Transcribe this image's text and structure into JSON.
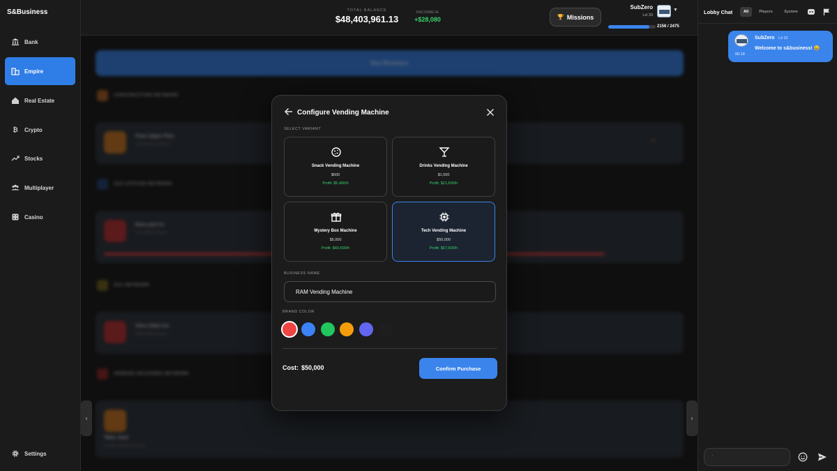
{
  "app": {
    "brand": "S&Business"
  },
  "sidebar": {
    "items": [
      {
        "label": "Bank",
        "icon": "bank-icon",
        "active": false
      },
      {
        "label": "Empire",
        "icon": "building-icon",
        "active": true
      },
      {
        "label": "Real Estate",
        "icon": "house-icon",
        "active": false
      },
      {
        "label": "Crypto",
        "icon": "bitcoin-icon",
        "active": false
      },
      {
        "label": "Stocks",
        "icon": "trend-icon",
        "active": false
      },
      {
        "label": "Multiplayer",
        "icon": "users-icon",
        "active": false
      },
      {
        "label": "Casino",
        "icon": "dice-icon",
        "active": false
      }
    ],
    "settings_label": "Settings"
  },
  "header": {
    "balance_label": "TOTAL BALANCE",
    "balance_value": "$48,403,961.13",
    "income_label": "INCOME/H",
    "income_value": "+$28,080",
    "missions_label": "Missions",
    "user": {
      "name": "SubZero",
      "level": "Lvl 33"
    },
    "xp": {
      "current": 2156,
      "max": 2475,
      "text": "2156 / 2475"
    }
  },
  "modal": {
    "title": "Configure Vending Machine",
    "select_variant_label": "SELECT VARIANT",
    "variants": [
      {
        "name": "Snack Vending Machine",
        "price": "$500",
        "profit": "Profit: $5,400/h",
        "icon": "cookie-icon",
        "selected": false
      },
      {
        "name": "Drinks Vending Machine",
        "price": "$1,500",
        "profit": "Profit: $21,600/h",
        "icon": "cocktail-icon",
        "selected": false
      },
      {
        "name": "Mystery Box Machine",
        "price": "$5,000",
        "profit": "Profit: $40,500/h",
        "icon": "gift-icon",
        "selected": false
      },
      {
        "name": "Tech Vending Machine",
        "price": "$50,000",
        "profit": "Profit: $67,500/h",
        "icon": "chip-icon",
        "selected": true
      }
    ],
    "business_name_label": "BUSINESS NAME",
    "business_name_value": "RAM Vending Machine",
    "brand_color_label": "BRAND COLOR",
    "brand_colors": [
      "#ef4444",
      "#3b82f6",
      "#22c55e",
      "#f59e0b",
      "#6366f1",
      "#1e1e1e"
    ],
    "selected_color": "#ef4444",
    "cost_label": "Cost:",
    "cost_value": "$50,000",
    "confirm_label": "Confirm Purchase"
  },
  "chat": {
    "title": "Lobby Chat",
    "tabs": [
      {
        "label": "All",
        "active": true
      },
      {
        "label": "Players",
        "active": false
      },
      {
        "label": "System",
        "active": false
      }
    ],
    "messages": [
      {
        "user": "SubZero",
        "level": "Lvl 33",
        "text": "Welcome to s&business! 😀",
        "time": "06:18"
      }
    ],
    "input_value": "`"
  },
  "background": {
    "buy_label": "Buy Business",
    "sections": [
      "CONSTRUCTION NETWORK",
      "GAS STATION NETWORK",
      "SAA NETWORK",
      "VENDING MACHINES NETWORK"
    ],
    "cards": [
      {
        "title": "Fixer Upper Plus",
        "subtitle": "Construction business"
      },
      {
        "title": "Rom and Co",
        "subtitle": "Gas station business"
      },
      {
        "title": "Ohm Video Inc",
        "subtitle": "SAA media business"
      },
      {
        "title": "Tales Jose",
        "subtitle": "Vending machine business"
      }
    ]
  },
  "colors": {
    "accent": "#3b84ec",
    "positive": "#37d36b",
    "panel": "#1c1c1c"
  }
}
